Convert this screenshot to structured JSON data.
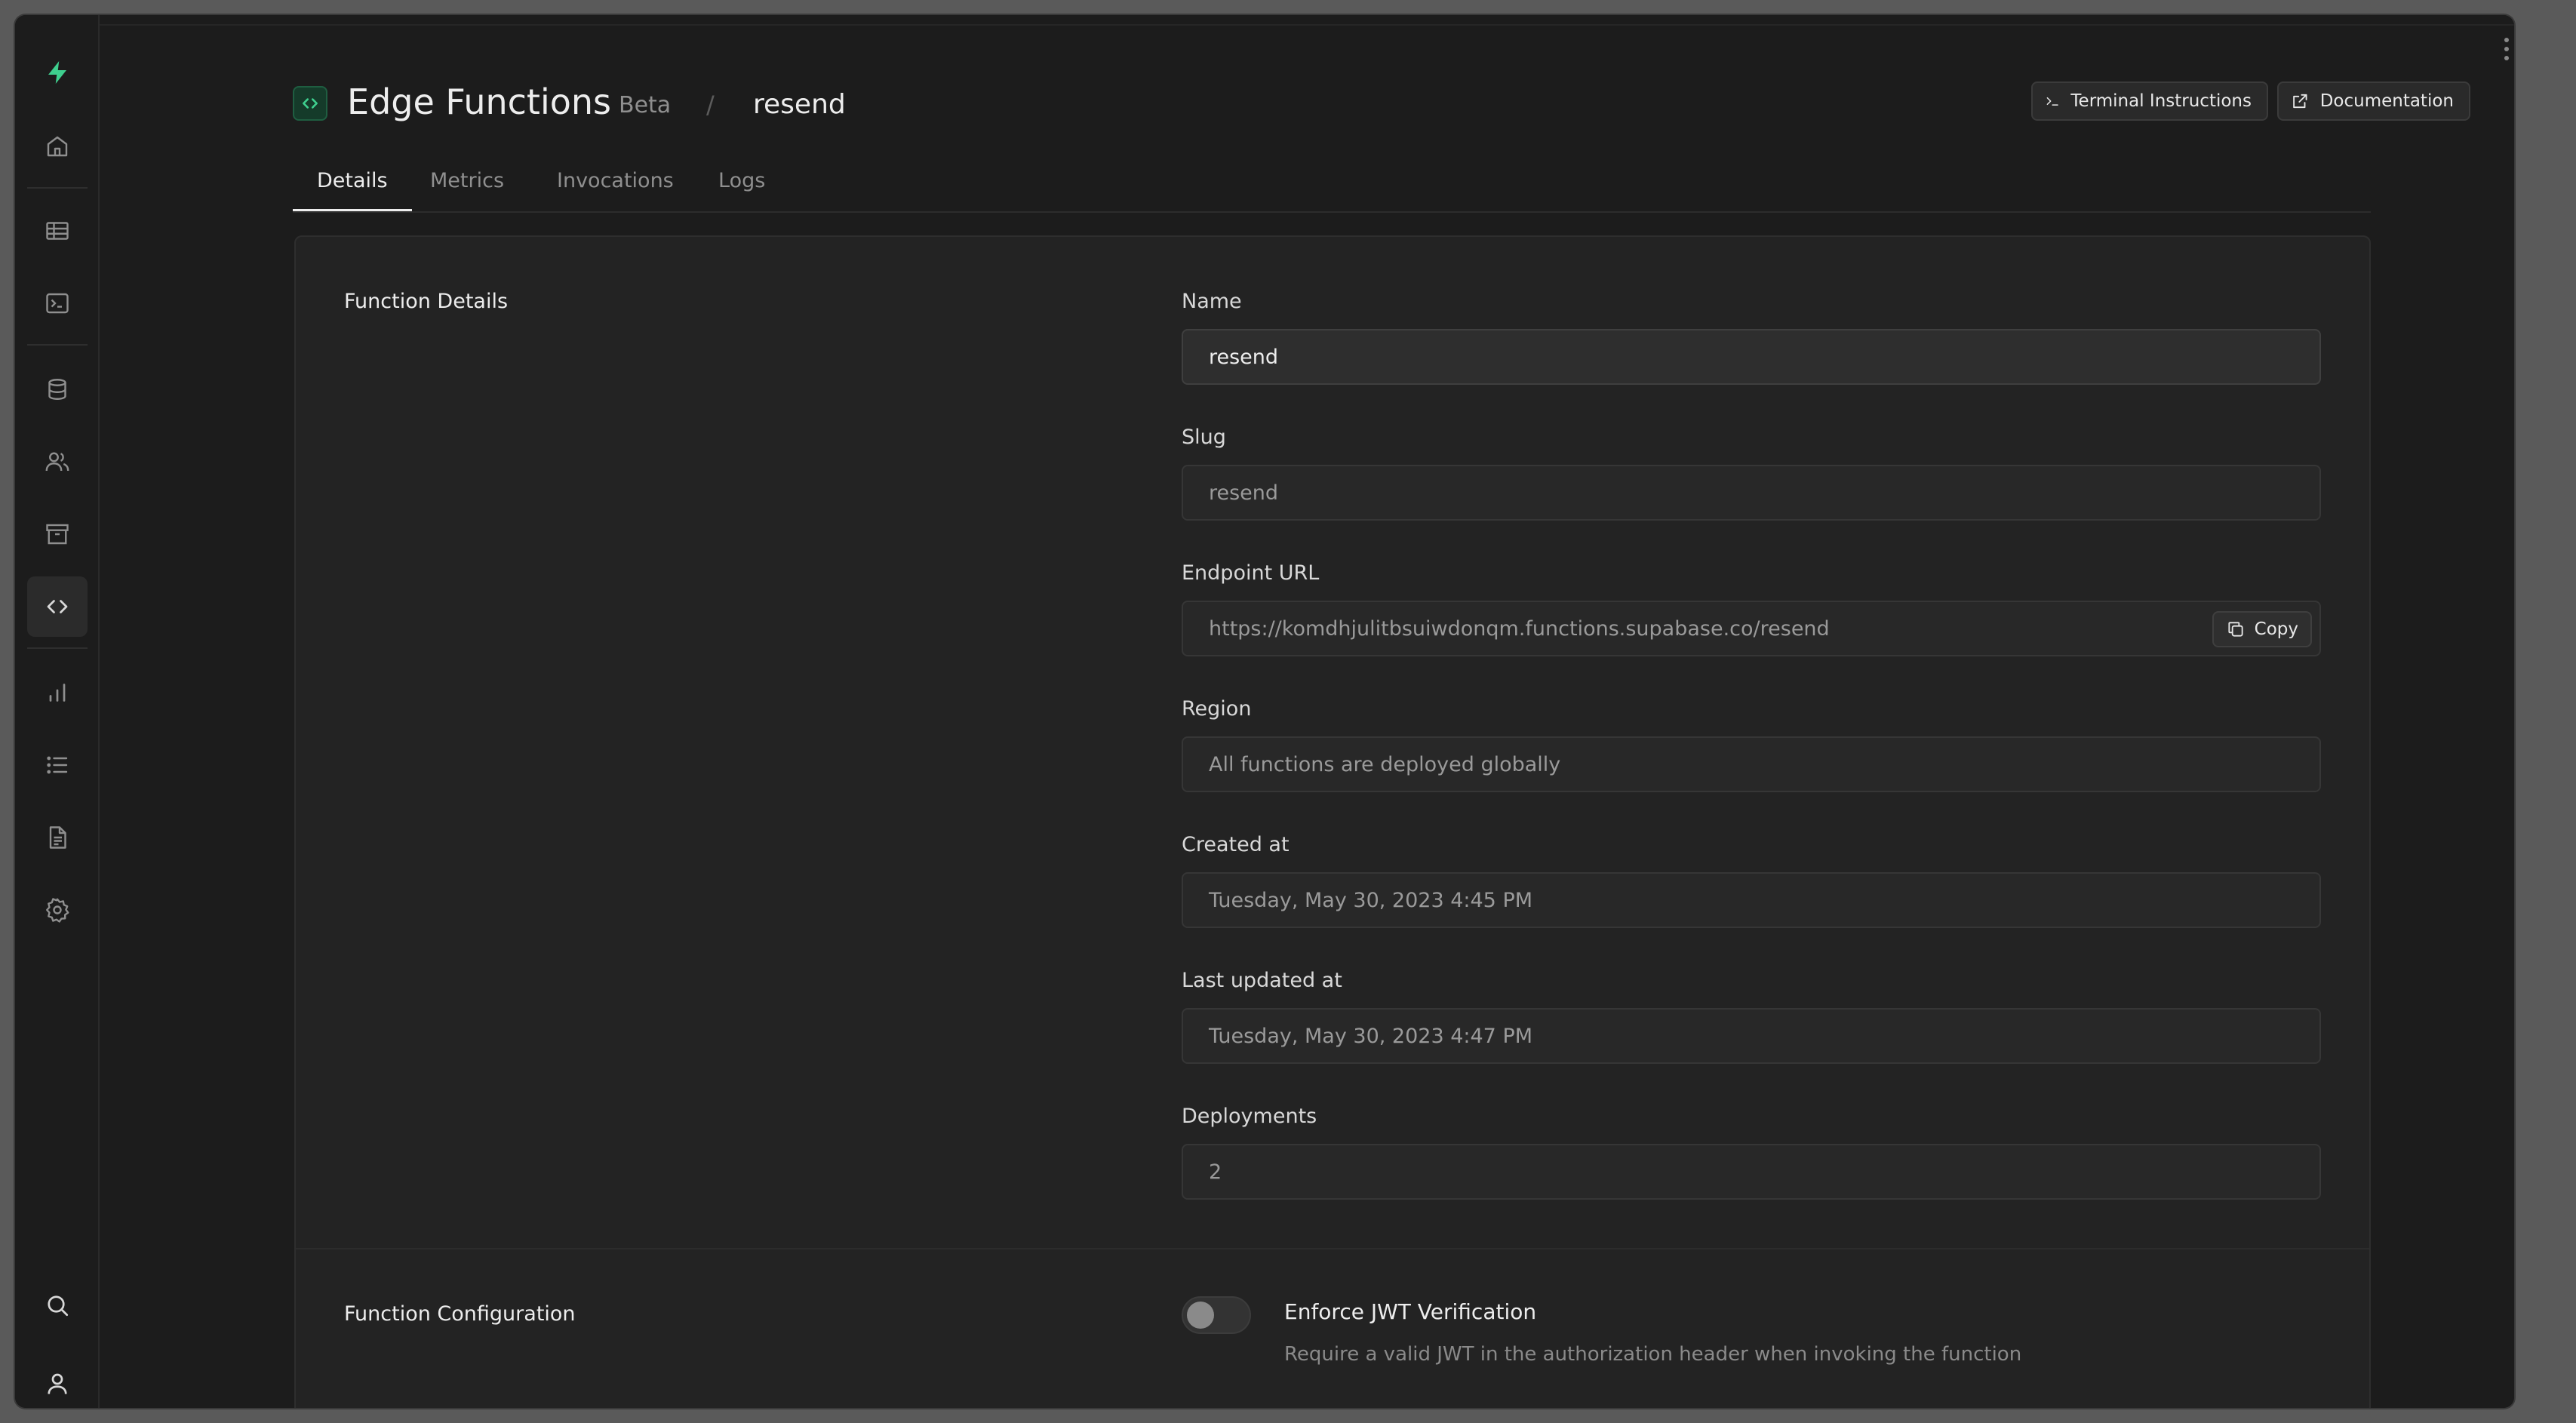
{
  "colors": {
    "brand": "#3ecf8e",
    "background": "#1c1c1c",
    "panel": "#232323"
  },
  "sidebar": {
    "items": [
      {
        "icon": "home-icon"
      },
      {
        "icon": "table-editor-icon"
      },
      {
        "icon": "sql-editor-icon"
      },
      {
        "icon": "database-icon"
      },
      {
        "icon": "auth-users-icon"
      },
      {
        "icon": "storage-archive-icon"
      },
      {
        "icon": "edge-functions-icon",
        "active": true
      },
      {
        "icon": "reports-icon"
      },
      {
        "icon": "logs-icon"
      },
      {
        "icon": "api-docs-icon"
      },
      {
        "icon": "settings-gear-icon"
      },
      {
        "icon": "search-icon"
      },
      {
        "icon": "user-icon"
      }
    ]
  },
  "header": {
    "title": "Edge Functions",
    "badge": "Beta",
    "separator": "/",
    "breadcrumb": "resend",
    "terminal_label": "Terminal Instructions",
    "docs_label": "Documentation"
  },
  "tabs": [
    {
      "label": "Details",
      "active": true
    },
    {
      "label": "Metrics"
    },
    {
      "label": "Invocations"
    },
    {
      "label": "Logs"
    }
  ],
  "details": {
    "section_title": "Function Details",
    "name_label": "Name",
    "name_value": "resend",
    "slug_label": "Slug",
    "slug_value": "resend",
    "endpoint_label": "Endpoint URL",
    "endpoint_value": "https://komdhjulitbsuiwdonqm.functions.supabase.co/resend",
    "copy_label": "Copy",
    "region_label": "Region",
    "region_value": "All functions are deployed globally",
    "created_label": "Created at",
    "created_value": "Tuesday, May 30, 2023 4:45 PM",
    "updated_label": "Last updated at",
    "updated_value": "Tuesday, May 30, 2023 4:47 PM",
    "deployments_label": "Deployments",
    "deployments_value": "2"
  },
  "configuration": {
    "section_title": "Function Configuration",
    "jwt_title": "Enforce JWT Verification",
    "jwt_description": "Require a valid JWT in the authorization header when invoking the function",
    "jwt_enabled": false
  }
}
